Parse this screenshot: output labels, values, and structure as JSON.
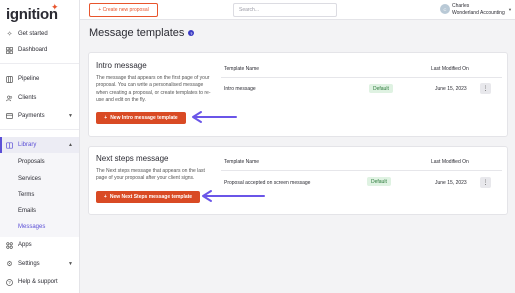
{
  "app": {
    "logo_text": "ignition"
  },
  "topbar": {
    "create_label": "+ Create new proposal",
    "search_placeholder": "Search...",
    "user_initials": "C",
    "user_name": "Charles",
    "user_org": "Wonderland Accounting"
  },
  "sidebar": {
    "items": [
      {
        "label": "Get started",
        "icon": "sparkle-icon"
      },
      {
        "label": "Dashboard",
        "icon": "grid-icon"
      },
      {
        "label": "Pipeline",
        "icon": "pipeline-icon"
      },
      {
        "label": "Clients",
        "icon": "users-icon"
      },
      {
        "label": "Payments",
        "icon": "card-icon"
      },
      {
        "label": "Library",
        "icon": "book-icon"
      },
      {
        "label": "Apps",
        "icon": "apps-icon"
      },
      {
        "label": "Settings",
        "icon": "gear-icon"
      },
      {
        "label": "Help & support",
        "icon": "help-icon"
      }
    ],
    "library_sub": [
      "Proposals",
      "Services",
      "Terms",
      "Emails",
      "Messages"
    ]
  },
  "page": {
    "title": "Message templates"
  },
  "table_headers": {
    "name": "Template Name",
    "modified": "Last Modified On"
  },
  "cards": [
    {
      "title": "Intro message",
      "description": "The message that appears on the first page of your proposal. You can write a personalised message when creating a proposal, or create templates to re-use and edit on the fly.",
      "button_label": "New Intro message template",
      "row": {
        "name": "Intro message",
        "badge": "Default",
        "date": "June 15, 2023"
      }
    },
    {
      "title": "Next steps message",
      "description": "The Next steps message that appears on the last page of your proposal after your client signs.",
      "button_label": "New Next Steps message template",
      "row": {
        "name": "Proposal accepted on screen message",
        "badge": "Default",
        "date": "June 15, 2023"
      }
    }
  ],
  "colors": {
    "brand": "#e8542c",
    "accent": "#5b4fd6",
    "badge_bg": "#dff2e2",
    "arrow": "#6a55e8"
  }
}
